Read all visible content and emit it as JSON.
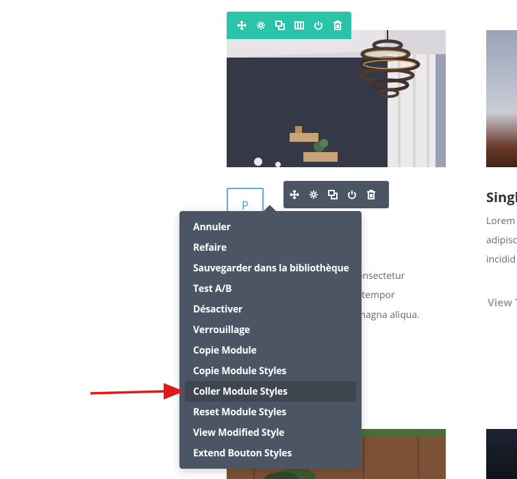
{
  "icons": {
    "move": "move-icon",
    "settings": "gear-icon",
    "duplicate": "duplicate-icon",
    "columns": "columns-icon",
    "save": "power-icon",
    "delete": "trash-icon"
  },
  "colors": {
    "toolbar_green": "#29c4a9",
    "menu_bg": "#4b5563",
    "menu_active": "#3e4650",
    "module_border": "#58b2d6",
    "arrow": "#e01919"
  },
  "module": {
    "letter": "P"
  },
  "card": {
    "lines": [
      "onsectetur",
      "l tempor",
      "magna aliqua."
    ]
  },
  "right_card": {
    "title": "Singl",
    "lines": [
      "Lorem",
      "adipisc",
      "incidid"
    ],
    "link": "View T"
  },
  "context_menu": {
    "items": [
      {
        "label": "Annuler"
      },
      {
        "label": "Refaire"
      },
      {
        "label": "Sauvegarder dans la bibliothèque"
      },
      {
        "label": "Test A/B"
      },
      {
        "label": "Désactiver"
      },
      {
        "label": "Verrouillage"
      },
      {
        "label": "Copie Module"
      },
      {
        "label": "Copie Module Styles"
      },
      {
        "label": "Coller Module Styles"
      },
      {
        "label": "Reset Module Styles"
      },
      {
        "label": "View Modified Style"
      },
      {
        "label": "Extend Bouton Styles"
      }
    ]
  }
}
